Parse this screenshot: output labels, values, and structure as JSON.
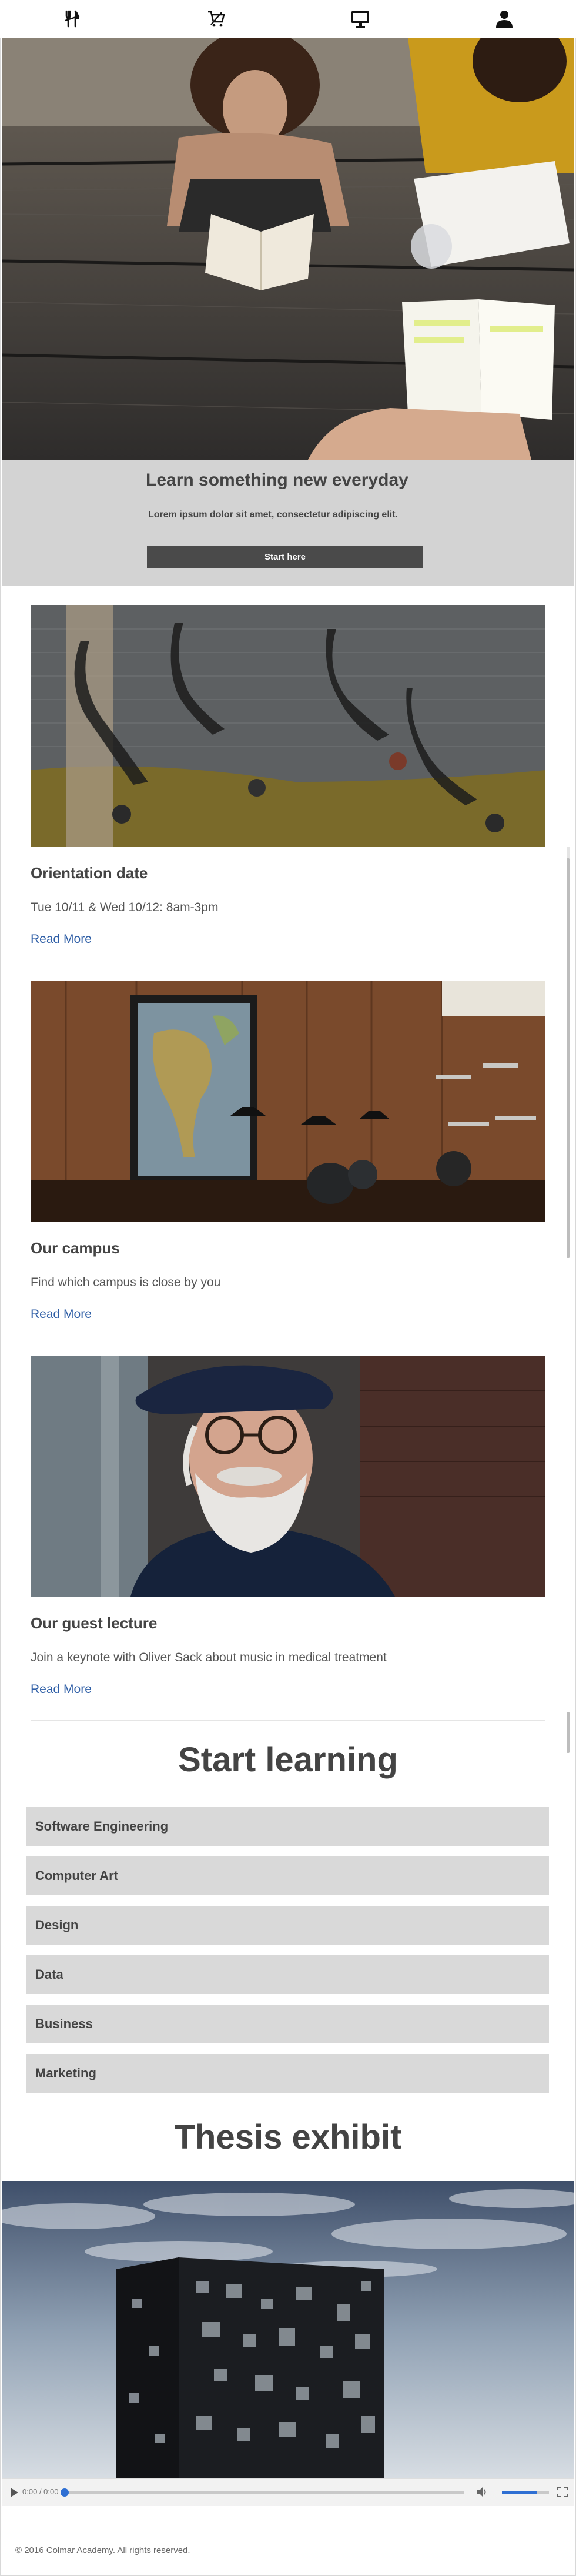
{
  "nav": {
    "items": [
      {
        "icon": "cutlery-icon"
      },
      {
        "icon": "cart-icon"
      },
      {
        "icon": "monitor-icon"
      },
      {
        "icon": "user-icon"
      }
    ]
  },
  "hero": {
    "title": "Learn something new everyday",
    "subtitle": "Lorem ipsum dolor sit amet, consectetur adipiscing elit.",
    "button_label": "Start here"
  },
  "cards": [
    {
      "title": "Orientation date",
      "text": "Tue 10/11 & Wed 10/12: 8am-3pm",
      "link": "Read More"
    },
    {
      "title": "Our campus",
      "text": "Find which campus is close by you",
      "link": "Read More"
    },
    {
      "title": "Our guest lecture",
      "text": "Join a keynote with Oliver Sack about music in medical treatment",
      "link": "Read More"
    }
  ],
  "start_learning": {
    "title": "Start learning",
    "courses": [
      "Software Engineering",
      "Computer Art",
      "Design",
      "Data",
      "Business",
      "Marketing"
    ]
  },
  "thesis": {
    "title": "Thesis exhibit",
    "video": {
      "time": "0:00 / 0:00",
      "progress": 0.0,
      "volume": 0.75
    }
  },
  "footer": {
    "text": "© 2016 Colmar Academy. All rights reserved."
  },
  "colors": {
    "link": "#2e5ea6",
    "panel": "#d3d3d3",
    "button": "#4a4a4a",
    "course_bg": "#d9d9d9"
  }
}
